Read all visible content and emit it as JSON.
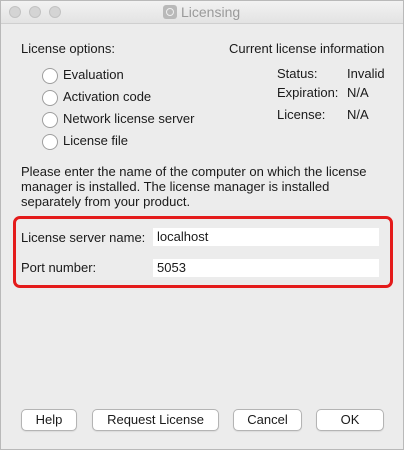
{
  "window": {
    "title": "Licensing"
  },
  "options": {
    "heading": "License options:",
    "items": [
      {
        "label": "Evaluation"
      },
      {
        "label": "Activation code"
      },
      {
        "label": "Network license server"
      },
      {
        "label": "License file"
      }
    ]
  },
  "current": {
    "heading": "Current license information",
    "status_label": "Status:",
    "status_value": "Invalid",
    "expiration_label": "Expiration:",
    "expiration_value": "N/A",
    "license_label": "License:",
    "license_value": "N/A"
  },
  "instructions": "Please enter the name of the computer on which the license manager is installed. The license manager is installed separately from your product.",
  "server": {
    "name_label": "License server name:",
    "name_value": "localhost",
    "port_label": "Port number:",
    "port_value": "5053",
    "highlight_color": "#e41b1b"
  },
  "buttons": {
    "help": "Help",
    "request": "Request License",
    "cancel": "Cancel",
    "ok": "OK"
  }
}
